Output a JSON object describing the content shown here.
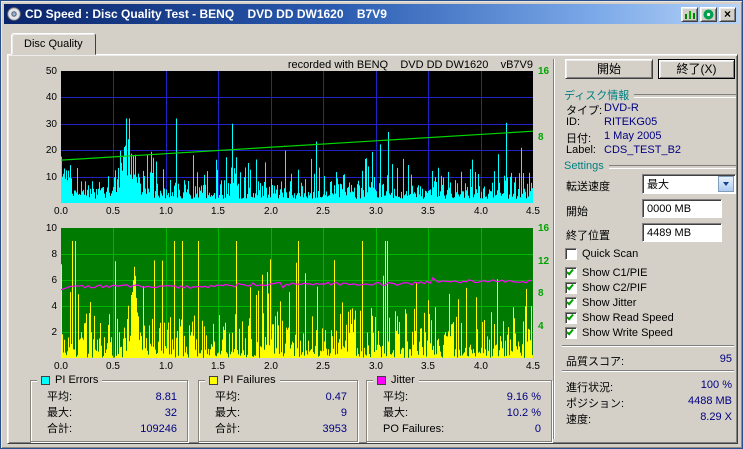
{
  "window": {
    "title": "CD Speed : Disc Quality Test - BENQ    DVD DD DW1620    B7V9"
  },
  "titlebar": {
    "close_glyph": "×"
  },
  "tabs": [
    {
      "label": "Disc Quality"
    }
  ],
  "chart_data": [
    {
      "type": "area",
      "title": "recorded with BENQ    DVD DD DW1620    vB7V9",
      "x_ticks": [
        "0.0",
        "0.5",
        "1.0",
        "1.5",
        "2.0",
        "2.5",
        "3.0",
        "3.5",
        "4.0",
        "4.5"
      ],
      "x_range": [
        0,
        4.5
      ],
      "x_data_max": 4.45,
      "y_left": {
        "ticks": [
          50,
          40,
          30,
          20,
          10
        ],
        "range": [
          0,
          50
        ]
      },
      "y_right": {
        "ticks": [
          16,
          8
        ],
        "range": [
          0,
          16
        ]
      },
      "bg": "#000000",
      "grid_color": "#2121c8",
      "series": [
        {
          "name": "PI Errors",
          "style": "spikes",
          "color": "#00ffff",
          "axis": "left",
          "avg": 8.81,
          "max": 32,
          "total": 109246
        },
        {
          "name": "Write Speed",
          "style": "line",
          "color": "#00d800",
          "axis": "right",
          "start_speed": 5.2,
          "end_speed": 8.7
        }
      ]
    },
    {
      "type": "area",
      "title": "",
      "x_ticks": [
        "0.0",
        "0.5",
        "1.0",
        "1.5",
        "2.0",
        "2.5",
        "3.0",
        "3.5",
        "4.0",
        "4.5"
      ],
      "x_range": [
        0,
        4.5
      ],
      "x_data_max": 4.45,
      "y_left": {
        "ticks": [
          10,
          8,
          6,
          4,
          2
        ],
        "range": [
          0,
          10
        ]
      },
      "y_right": {
        "ticks": [
          16,
          12,
          8,
          4
        ],
        "range": [
          0,
          16
        ]
      },
      "bg": "#007a00",
      "grid_color": "#00b400",
      "series": [
        {
          "name": "PI Failures",
          "style": "spikes",
          "color": "#ffff00",
          "axis": "left",
          "avg": 0.47,
          "max": 9,
          "total": 3953
        },
        {
          "name": "Jitter",
          "style": "noisy-line",
          "color": "#ff00ff",
          "axis": "right",
          "avg": 9.16,
          "max": 10.2
        }
      ]
    }
  ],
  "stats": [
    {
      "title": "PI Errors",
      "color": "#00ffff",
      "rows": [
        [
          "平均:",
          "8.81"
        ],
        [
          "最大:",
          "32"
        ],
        [
          "合計:",
          "109246"
        ]
      ]
    },
    {
      "title": "PI Failures",
      "color": "#ffff00",
      "rows": [
        [
          "平均:",
          "0.47"
        ],
        [
          "最大:",
          "9"
        ],
        [
          "合計:",
          "3953"
        ]
      ]
    },
    {
      "title": "Jitter",
      "color": "#ff00ff",
      "rows": [
        [
          "平均:",
          "9.16 %"
        ],
        [
          "最大:",
          "10.2 %"
        ],
        [
          "PO Failures:",
          "0"
        ]
      ]
    }
  ],
  "panel": {
    "start_button": "開始",
    "exit_button": "終了(X)",
    "disc_info": {
      "header": "ディスク情報",
      "rows": [
        {
          "label": "タイプ:",
          "value": "DVD-R"
        },
        {
          "label": "ID:",
          "value": "RITEKG05"
        },
        {
          "label": "日付:",
          "value": "1 May 2005"
        },
        {
          "label": "Label:",
          "value": "CDS_TEST_B2"
        }
      ]
    },
    "settings": {
      "header": "Settings",
      "speed_label": "転送速度",
      "speed_value": "最大",
      "start_label": "開始",
      "start_value": "0000 MB",
      "end_label": "終了位置",
      "end_value": "4489 MB",
      "checkboxes": [
        {
          "label": "Quick Scan",
          "checked": false
        },
        {
          "label": "Show C1/PIE",
          "checked": true
        },
        {
          "label": "Show C2/PIF",
          "checked": true
        },
        {
          "label": "Show Jitter",
          "checked": true
        },
        {
          "label": "Show Read Speed",
          "checked": true
        },
        {
          "label": "Show Write Speed",
          "checked": true
        }
      ]
    },
    "score": {
      "label": "品質スコア:",
      "value": "95"
    },
    "status": [
      {
        "label": "進行状況:",
        "value": "100 %"
      },
      {
        "label": "ポジション:",
        "value": "4488 MB"
      },
      {
        "label": "速度:",
        "value": "8.29 X"
      }
    ]
  }
}
